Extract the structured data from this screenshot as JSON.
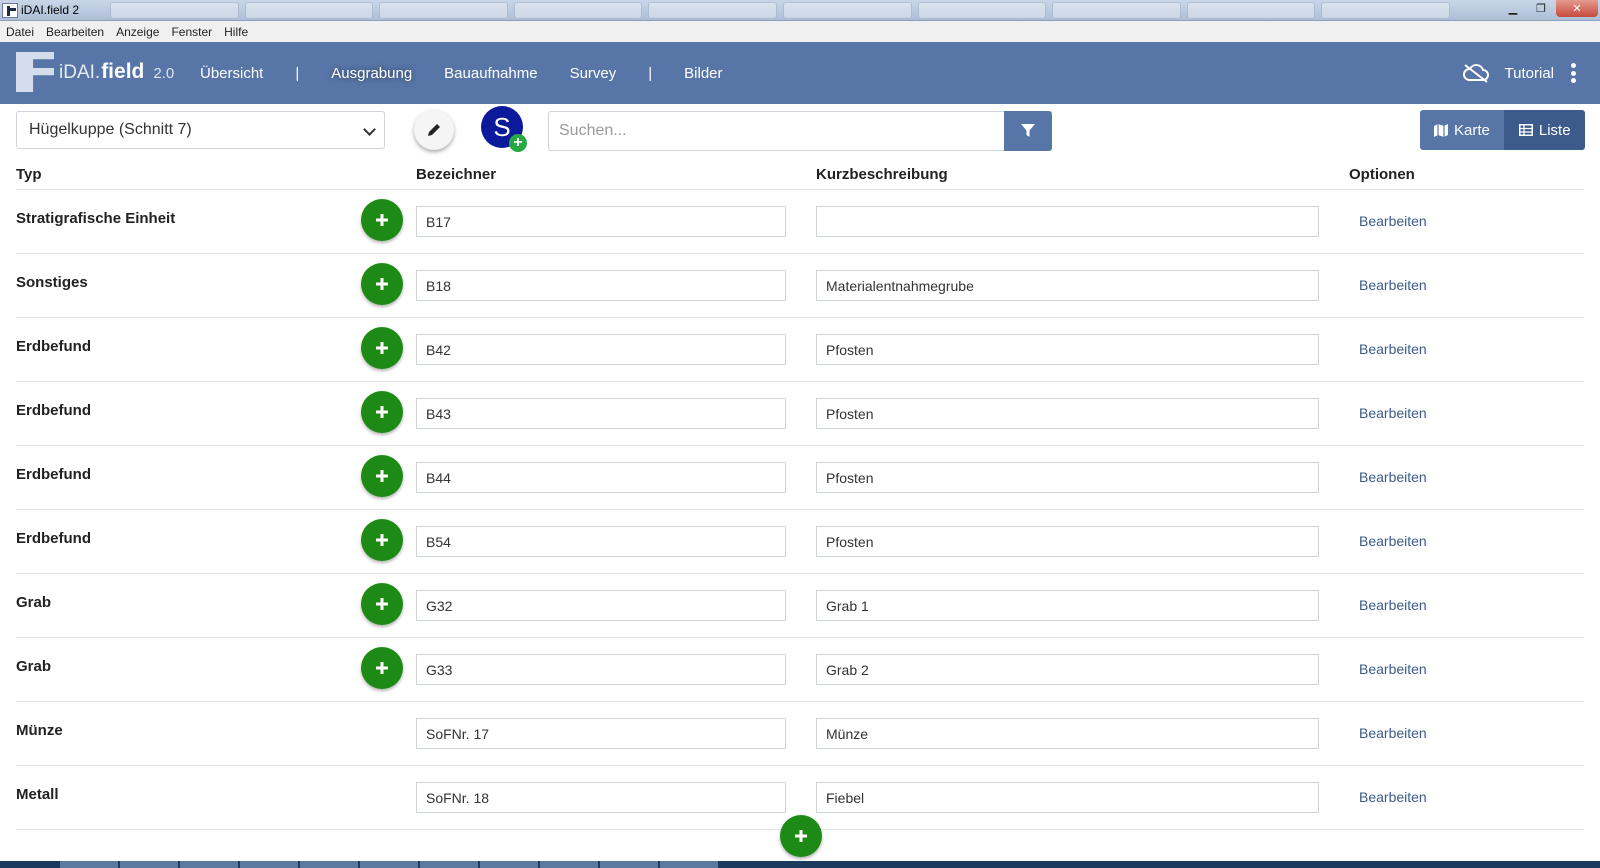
{
  "window": {
    "title": "iDAI.field 2"
  },
  "menu": [
    "Datei",
    "Bearbeiten",
    "Anzeige",
    "Fenster",
    "Hilfe"
  ],
  "navbar": {
    "brand_prefix": "iDAI.",
    "brand_main": "field",
    "version": "2.0",
    "items": [
      "Übersicht",
      "|",
      "Ausgrabung",
      "Bauaufnahme",
      "Survey",
      "|",
      "Bilder"
    ],
    "active": "Ausgrabung",
    "tutorial": "Tutorial"
  },
  "toolbar": {
    "operation_select": "Hügelkuppe (Schnitt 7)",
    "s_button": "S",
    "search_placeholder": "Suchen...",
    "karte": "Karte",
    "liste": "Liste"
  },
  "table": {
    "headers": {
      "typ": "Typ",
      "bezeichner": "Bezeichner",
      "kurz": "Kurzbeschreibung",
      "optionen": "Optionen"
    },
    "edit_label": "Bearbeiten",
    "rows": [
      {
        "typ": "Stratigrafische Einheit",
        "bez": "B17",
        "kurz": ""
      },
      {
        "typ": "Sonstiges",
        "bez": "B18",
        "kurz": "Materialentnahmegrube"
      },
      {
        "typ": "Erdbefund",
        "bez": "B42",
        "kurz": "Pfosten"
      },
      {
        "typ": "Erdbefund",
        "bez": "B43",
        "kurz": "Pfosten"
      },
      {
        "typ": "Erdbefund",
        "bez": "B44",
        "kurz": "Pfosten"
      },
      {
        "typ": "Erdbefund",
        "bez": "B54",
        "kurz": "Pfosten"
      },
      {
        "typ": "Grab",
        "bez": "G32",
        "kurz": "Grab 1"
      },
      {
        "typ": "Grab",
        "bez": "G33",
        "kurz": "Grab 2"
      },
      {
        "typ": "Münze",
        "bez": "SoFNr. 17",
        "kurz": "Münze"
      },
      {
        "typ": "Metall",
        "bez": "SoFNr. 18",
        "kurz": "Fiebel"
      }
    ]
  },
  "colors": {
    "navbar": "#5775a6",
    "add_green": "#1e8a16",
    "link": "#3c5a8c"
  }
}
